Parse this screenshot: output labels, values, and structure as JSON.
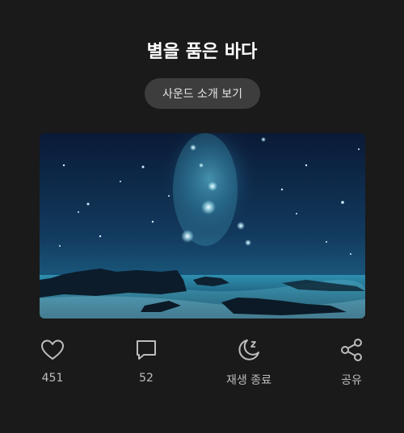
{
  "header": {
    "title": "별을 품은 바다",
    "intro_button_label": "사운드 소개 보기"
  },
  "image": {
    "description_icon": "starry-sea-image"
  },
  "actions": [
    {
      "key": "like",
      "icon": "heart-icon",
      "label": "451"
    },
    {
      "key": "comment",
      "icon": "comment-icon",
      "label": "52"
    },
    {
      "key": "sleep",
      "icon": "moon-sleep-icon",
      "label": "재생 종료"
    },
    {
      "key": "share",
      "icon": "share-icon",
      "label": "공유"
    }
  ],
  "colors": {
    "background": "#1a1a1a",
    "button_bg": "#3d3d3d",
    "icon": "#bdbdbd"
  }
}
